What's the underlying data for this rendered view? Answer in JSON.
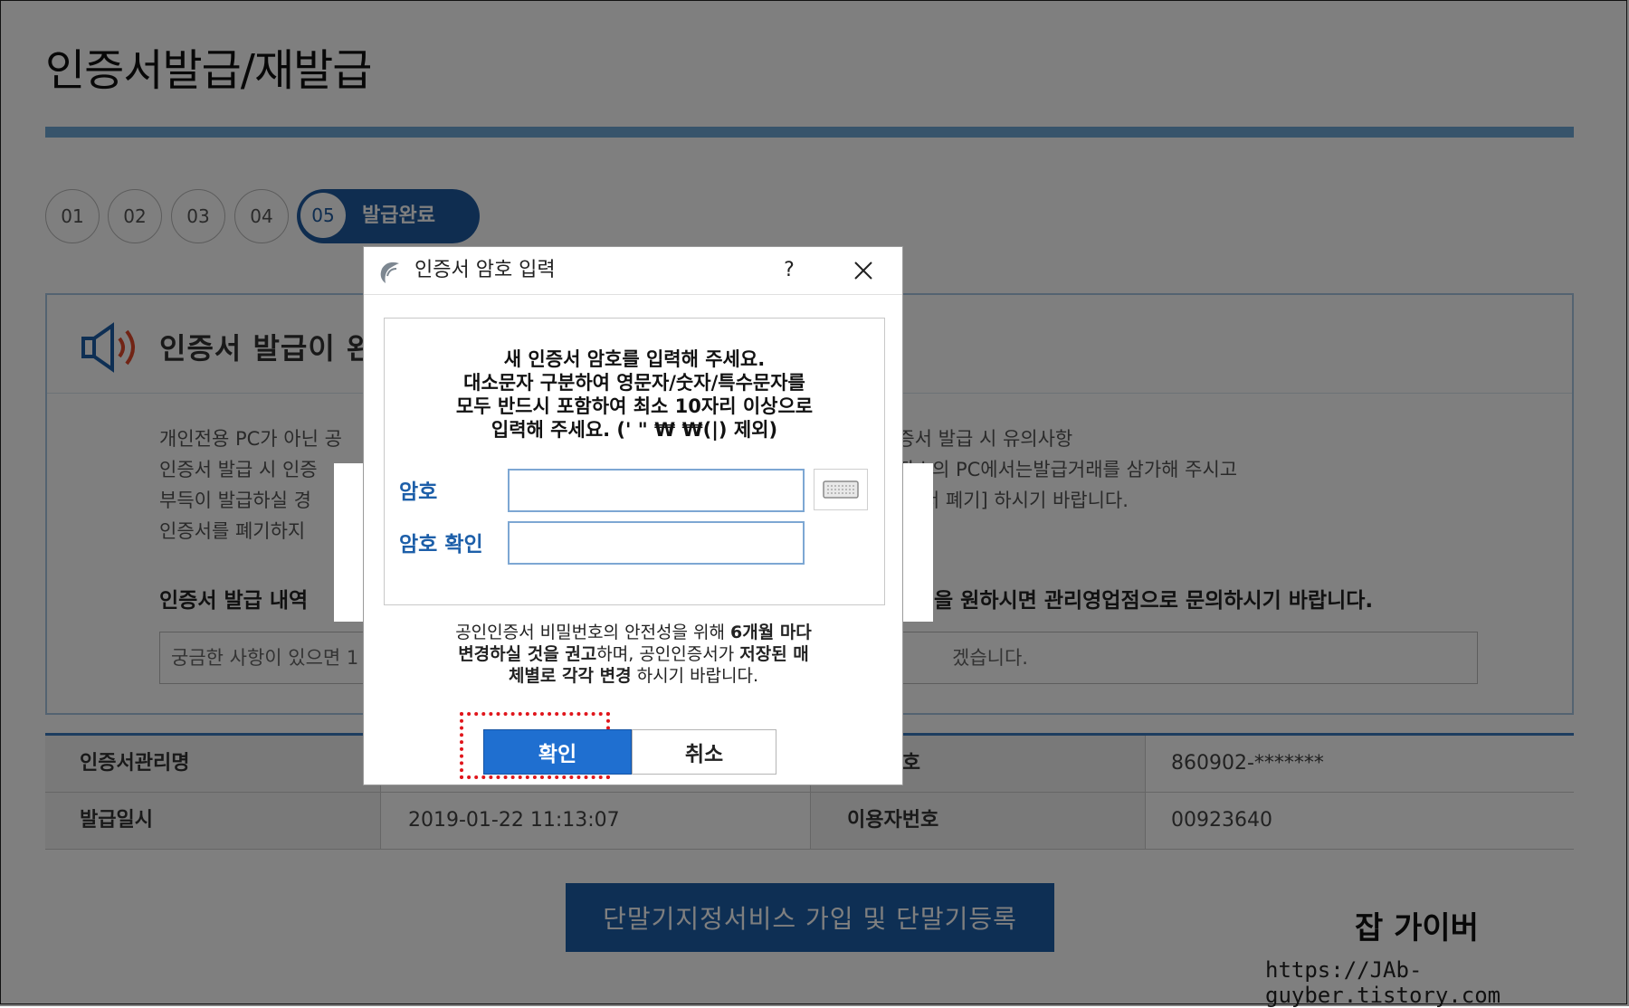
{
  "page": {
    "title": "인증서발급/재발급",
    "steps": [
      {
        "num": "01"
      },
      {
        "num": "02"
      },
      {
        "num": "03"
      },
      {
        "num": "04"
      },
      {
        "num": "05",
        "label": "발급완료",
        "active": true
      }
    ],
    "notice": {
      "title": "인증서 발급이 완",
      "lines_left": [
        "개인전용 PC가 아닌 공",
        "인증서 발급 시 인증",
        "부득이 발급하실 경",
        "인증서를 폐기하지"
      ],
      "lines_right": [
        "인증서 발급 시 유의사항",
        "공장소의 PC에서는발급거래를 삼가해 주시고",
        "[인증서 폐기] 하시기 바랍니다."
      ],
      "history_label": "인증서 발급 내역",
      "history_right": "을 원하시면 관리영업점으로 문의하시기 바랍니다.",
      "question_left": "궁금한 사항이 있으면 1",
      "question_right": "겠습니다."
    },
    "info_table": [
      {
        "h1": "인증서관리명",
        "v1": "",
        "h2": "등록번호",
        "v2": "860902-*******"
      },
      {
        "h1": "발급일시",
        "v1": "2019-01-22 11:13:07",
        "h2": "이용자번호",
        "v2": "00923640"
      }
    ],
    "register_button": "단말기지정서비스 가입 및 단말기등록"
  },
  "dialog": {
    "title": "인증서 암호 입력",
    "help": "?",
    "instructions": [
      "새 인증서 암호를 입력해 주세요.",
      "대소문자 구분하여 영문자/숫자/특수문자를",
      "모두 반드시 포함하여 최소 10자리 이상으로",
      "입력해 주세요. (' \" ₩ ₩(|) 제외)"
    ],
    "password_label": "암호",
    "password_confirm_label": "암호 확인",
    "note": {
      "p1": "공인인증서 비밀번호의 안전성을 위해 ",
      "b1": "6개월 마다",
      "b2": "변경하실 것을 권고",
      "p2": "하며, 공인인증서가 ",
      "b3": "저장된 매",
      "b4": "체별로 각각 변경",
      "p3": " 하시기 바랍니다."
    },
    "ok_label": "확인",
    "cancel_label": "취소"
  },
  "watermark": {
    "name": "잡 가이버",
    "url": "https://JAb-guyber.tistory.com"
  },
  "colors": {
    "brand_blue": "#1d5fa9",
    "ok_button": "#1f6fd0",
    "highlight": "#e0151b",
    "title_rule": "#6fa9d6"
  }
}
